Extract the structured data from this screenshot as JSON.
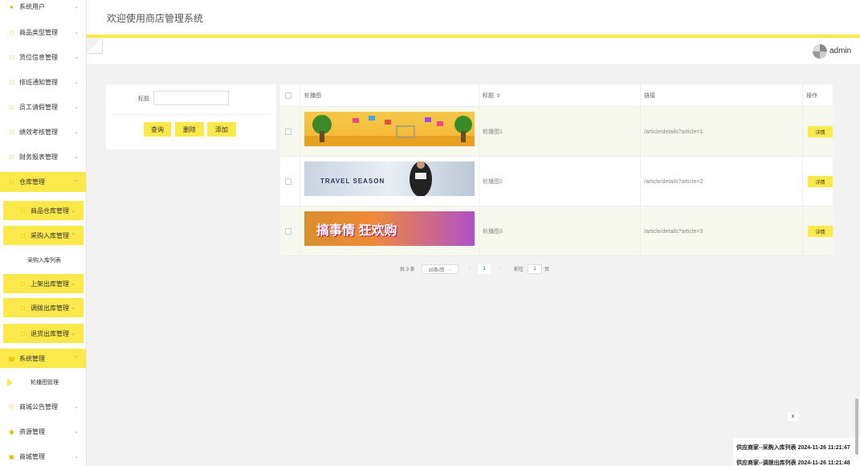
{
  "header": {
    "title": "欢迎使用商店管理系统",
    "username": "admin"
  },
  "sidebar": {
    "items": [
      {
        "label": "系统用户",
        "icon": "person-icon"
      },
      {
        "label": "商品类型管理",
        "icon": "folder-icon"
      },
      {
        "label": "货位信息管理",
        "icon": "folder-icon"
      },
      {
        "label": "排班通知管理",
        "icon": "folder-icon"
      },
      {
        "label": "员工请假管理",
        "icon": "folder-icon"
      },
      {
        "label": "绩效考核管理",
        "icon": "folder-icon"
      },
      {
        "label": "财务报表管理",
        "icon": "folder-icon"
      },
      {
        "label": "仓库管理",
        "icon": "folder-icon"
      },
      {
        "label": "商品仓库管理",
        "icon": "folder-icon"
      },
      {
        "label": "采购入库管理",
        "icon": "folder-icon"
      },
      {
        "label": "采购入库列表",
        "icon": ""
      },
      {
        "label": "上架出库管理",
        "icon": "folder-icon"
      },
      {
        "label": "调拨出库管理",
        "icon": "folder-icon"
      },
      {
        "label": "退货出库管理",
        "icon": "folder-icon"
      },
      {
        "label": "系统管理",
        "icon": "grid-icon"
      },
      {
        "label": "轮播图管理",
        "icon": ""
      },
      {
        "label": "商城公告管理",
        "icon": "info-icon"
      },
      {
        "label": "资源管理",
        "icon": "bulb-icon"
      },
      {
        "label": "商城管理",
        "icon": "cart-icon"
      }
    ]
  },
  "filter": {
    "label": "标题",
    "placeholder": "",
    "query_btn": "查询",
    "delete_btn": "删除",
    "add_btn": "添加"
  },
  "table": {
    "headers": {
      "image": "轮播图",
      "title": "标题",
      "link": "链接",
      "action": "操作"
    },
    "rows": [
      {
        "title": "轮播图1",
        "link": "/article/details?article=1",
        "action": "详情"
      },
      {
        "title": "轮播图2",
        "link": "/article/details?article=2",
        "action": "详情"
      },
      {
        "title": "轮播图3",
        "link": "/article/details?article=3",
        "action": "详情"
      }
    ],
    "banner2_text": "TRAVEL SEASON",
    "banner3_text": "搞事情 狂欢购"
  },
  "pager": {
    "total": "共 3 条",
    "page_size": "10条/页",
    "prev": "‹",
    "current": "1",
    "next": "›",
    "goto": "前往",
    "goto_value": "1",
    "page_suffix": "页"
  },
  "notifications": [
    {
      "text": "供应商家--采购入库列表 2024-11-26 11:21:47"
    },
    {
      "text": "供应商家--调拨出库列表 2024-11-26 11:21:48"
    }
  ],
  "close_label": "x",
  "colors": {
    "accent": "#fbe84a",
    "background": "#f2f2f2"
  }
}
